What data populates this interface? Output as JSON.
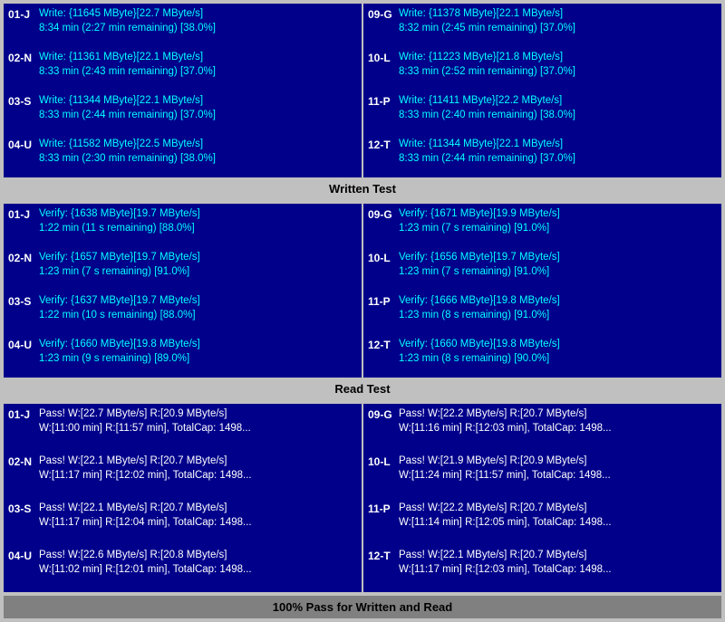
{
  "sections": {
    "write": {
      "header": "Written Test",
      "left": [
        {
          "label": "01-J",
          "line1": "Write: {11645 MByte}[22.7 MByte/s]",
          "line2": "8:34 min (2:27 min remaining)  [38.0%]"
        },
        {
          "label": "02-N",
          "line1": "Write: {11361 MByte}[22.1 MByte/s]",
          "line2": "8:33 min (2:43 min remaining)  [37.0%]"
        },
        {
          "label": "03-S",
          "line1": "Write: {11344 MByte}[22.1 MByte/s]",
          "line2": "8:33 min (2:44 min remaining)  [37.0%]"
        },
        {
          "label": "04-U",
          "line1": "Write: {11582 MByte}[22.5 MByte/s]",
          "line2": "8:33 min (2:30 min remaining)  [38.0%]"
        }
      ],
      "right": [
        {
          "label": "09-G",
          "line1": "Write: {11378 MByte}[22.1 MByte/s]",
          "line2": "8:32 min (2:45 min remaining)  [37.0%]"
        },
        {
          "label": "10-L",
          "line1": "Write: {11223 MByte}[21.8 MByte/s]",
          "line2": "8:33 min (2:52 min remaining)  [37.0%]"
        },
        {
          "label": "11-P",
          "line1": "Write: {11411 MByte}[22.2 MByte/s]",
          "line2": "8:33 min (2:40 min remaining)  [38.0%]"
        },
        {
          "label": "12-T",
          "line1": "Write: {11344 MByte}[22.1 MByte/s]",
          "line2": "8:33 min (2:44 min remaining)  [37.0%]"
        }
      ]
    },
    "verify": {
      "left": [
        {
          "label": "01-J",
          "line1": "Verify: {1638 MByte}[19.7 MByte/s]",
          "line2": "1:22 min (11 s remaining)   [88.0%]"
        },
        {
          "label": "02-N",
          "line1": "Verify: {1657 MByte}[19.7 MByte/s]",
          "line2": "1:23 min (7 s remaining)   [91.0%]"
        },
        {
          "label": "03-S",
          "line1": "Verify: {1637 MByte}[19.7 MByte/s]",
          "line2": "1:22 min (10 s remaining)   [88.0%]"
        },
        {
          "label": "04-U",
          "line1": "Verify: {1660 MByte}[19.8 MByte/s]",
          "line2": "1:23 min (9 s remaining)   [89.0%]"
        }
      ],
      "right": [
        {
          "label": "09-G",
          "line1": "Verify: {1671 MByte}[19.9 MByte/s]",
          "line2": "1:23 min (7 s remaining)   [91.0%]"
        },
        {
          "label": "10-L",
          "line1": "Verify: {1656 MByte}[19.7 MByte/s]",
          "line2": "1:23 min (7 s remaining)   [91.0%]"
        },
        {
          "label": "11-P",
          "line1": "Verify: {1666 MByte}[19.8 MByte/s]",
          "line2": "1:23 min (8 s remaining)   [91.0%]"
        },
        {
          "label": "12-T",
          "line1": "Verify: {1660 MByte}[19.8 MByte/s]",
          "line2": "1:23 min (8 s remaining)   [90.0%]"
        }
      ]
    },
    "read": {
      "header": "Read Test",
      "left": [
        {
          "label": "01-J",
          "line1": "Pass! W:[22.7 MByte/s] R:[20.9 MByte/s]",
          "line2": "W:[11:00 min] R:[11:57 min], TotalCap: 1498..."
        },
        {
          "label": "02-N",
          "line1": "Pass! W:[22.1 MByte/s] R:[20.7 MByte/s]",
          "line2": "W:[11:17 min] R:[12:02 min], TotalCap: 1498..."
        },
        {
          "label": "03-S",
          "line1": "Pass! W:[22.1 MByte/s] R:[20.7 MByte/s]",
          "line2": "W:[11:17 min] R:[12:04 min], TotalCap: 1498..."
        },
        {
          "label": "04-U",
          "line1": "Pass! W:[22.6 MByte/s] R:[20.8 MByte/s]",
          "line2": "W:[11:02 min] R:[12:01 min], TotalCap: 1498..."
        }
      ],
      "right": [
        {
          "label": "09-G",
          "line1": "Pass! W:[22.2 MByte/s] R:[20.7 MByte/s]",
          "line2": "W:[11:16 min] R:[12:03 min], TotalCap: 1498..."
        },
        {
          "label": "10-L",
          "line1": "Pass! W:[21.9 MByte/s] R:[20.9 MByte/s]",
          "line2": "W:[11:24 min] R:[11:57 min], TotalCap: 1498..."
        },
        {
          "label": "11-P",
          "line1": "Pass! W:[22.2 MByte/s] R:[20.7 MByte/s]",
          "line2": "W:[11:14 min] R:[12:05 min], TotalCap: 1498..."
        },
        {
          "label": "12-T",
          "line1": "Pass! W:[22.1 MByte/s] R:[20.7 MByte/s]",
          "line2": "W:[11:17 min] R:[12:03 min], TotalCap: 1498..."
        }
      ]
    }
  },
  "headers": {
    "written_test": "Written Test",
    "read_test": "Read Test"
  },
  "footer": "100% Pass for Written and Read"
}
